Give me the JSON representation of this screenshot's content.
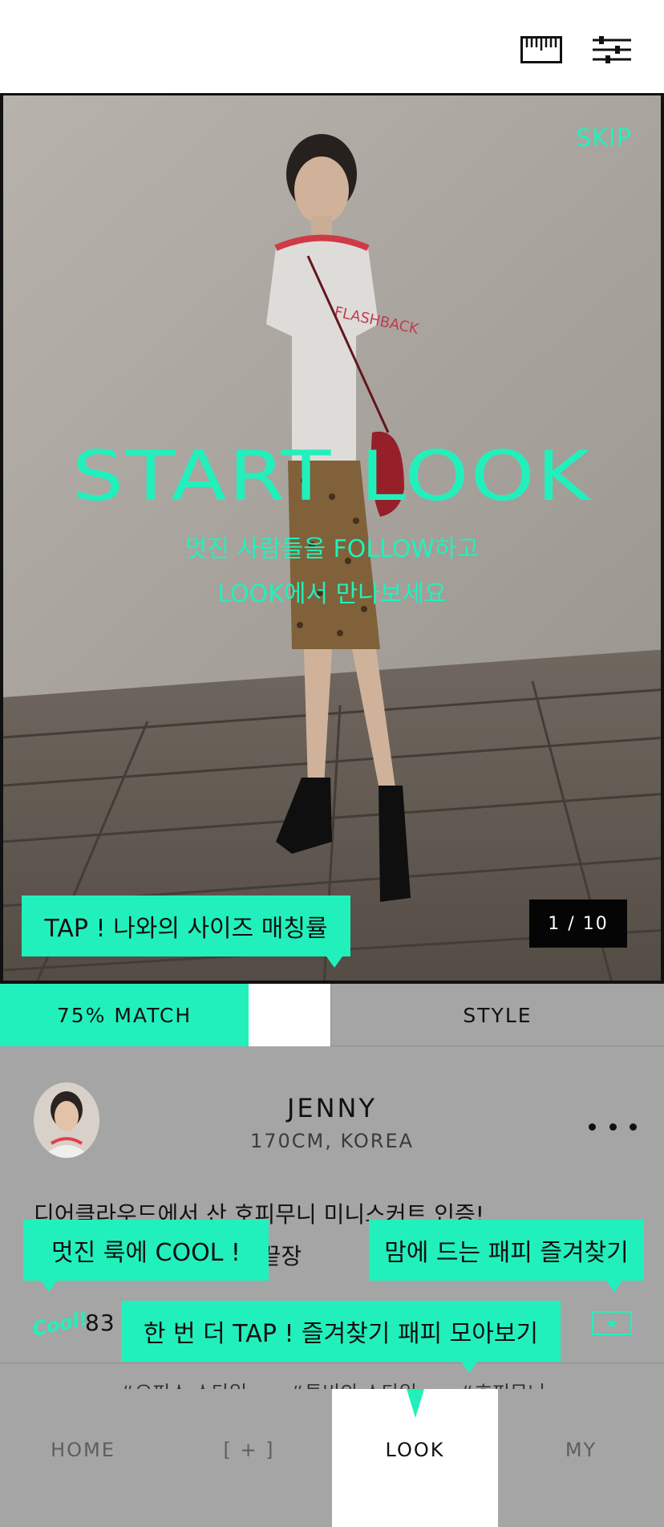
{
  "topbar": {
    "ruler_icon": "ruler-icon",
    "filter_icon": "sliders-icon"
  },
  "hero": {
    "skip_label": "SKIP",
    "title": "START LOOK",
    "subtitle_line1": "멋진 사람들을 FOLLOW하고",
    "subtitle_line2": "LOOK에서 만나보세요",
    "counter": "1 / 10"
  },
  "tooltips": {
    "size_match": "TAP ! 나와의 사이즈 매칭률",
    "cool": "멋진 룩에 COOL !",
    "favorite": "맘에 드는 패피 즐겨찾기",
    "tap_again": "한 번 더 TAP !  즐겨찾기 패피 모아보기"
  },
  "tabs": {
    "match_label": "75% MATCH",
    "match_percent": 75,
    "style_label": "STYLE"
  },
  "post": {
    "user_name": "JENNY",
    "user_meta": "170CM, KOREA",
    "caption_line1": "디어클라우드에서 산 호피무니 미니스커트 인증!",
    "caption_line2_visible": "면 끝장",
    "cool_mark": "Cool!",
    "cool_count": "83",
    "hashtags": [
      "#오피스 스타일",
      "#투비의 스타일",
      "#호피무니"
    ]
  },
  "nav": {
    "home": "HOME",
    "add": "[ + ]",
    "look": "LOOK",
    "my": "MY",
    "active": "LOOK"
  },
  "colors": {
    "accent": "#22f0bc",
    "panel_gray": "#a5a5a5",
    "counter_bg": "#050505"
  }
}
